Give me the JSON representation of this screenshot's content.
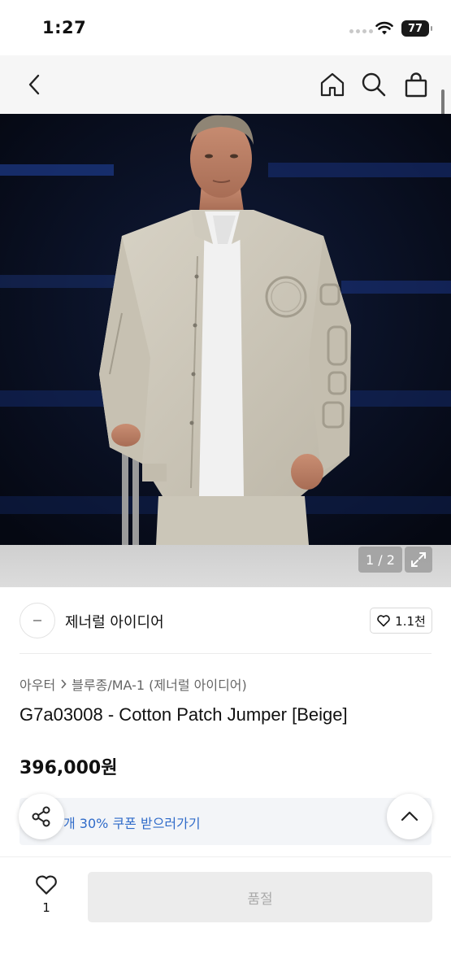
{
  "status_bar": {
    "time": "1:27",
    "battery": "77"
  },
  "nav": {
    "icons": [
      "back-icon",
      "home-icon",
      "search-icon",
      "bag-icon"
    ]
  },
  "gallery": {
    "counter": "1 / 2"
  },
  "brand": {
    "name": "제너럴 아이디어",
    "likes": "1.1천"
  },
  "breadcrumb": {
    "category": "아우터",
    "subcategory": "블루종/MA-1 (제너럴 아이디어)"
  },
  "product": {
    "title": "G7a03008 - Cotton Patch Jumper [Beige]",
    "price": "396,000원"
  },
  "coupon": {
    "text": "개 30% 쿠폰 받으러가기"
  },
  "bottom": {
    "wish_count": "1",
    "buy_label": "품절"
  },
  "colors": {
    "accent_blue": "#2f6bc9",
    "disabled_bg": "#ececec",
    "disabled_text": "#aaaaaa"
  }
}
